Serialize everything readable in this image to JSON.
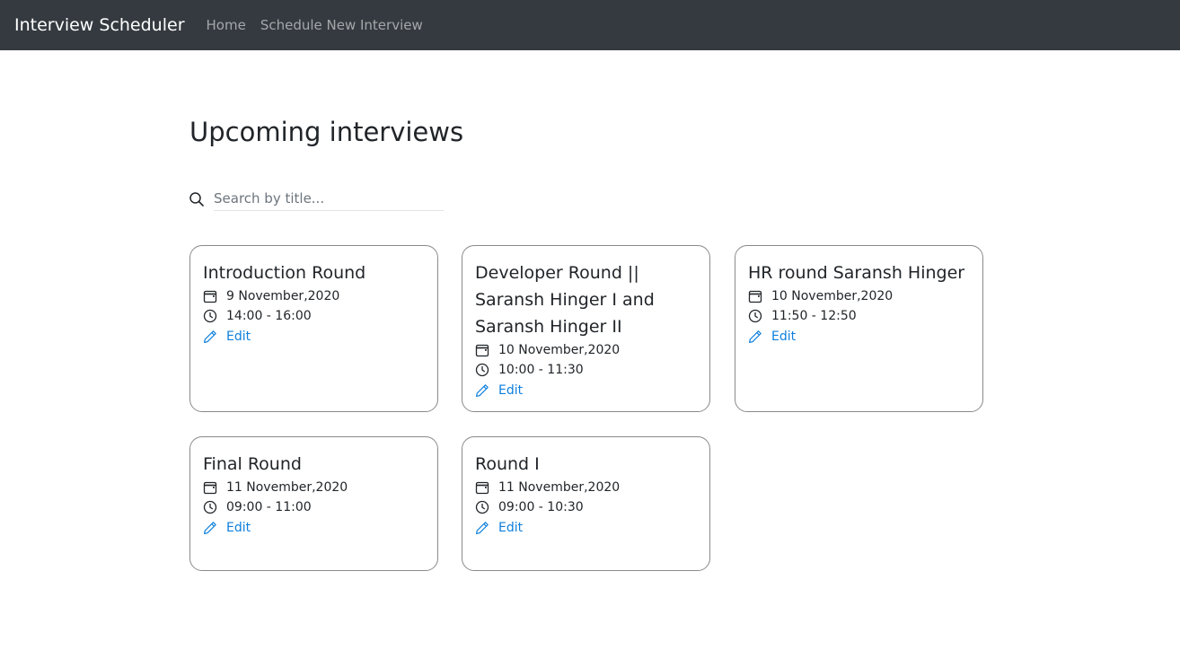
{
  "navbar": {
    "brand": "Interview Scheduler",
    "links": [
      "Home",
      "Schedule New Interview"
    ]
  },
  "main": {
    "title": "Upcoming interviews",
    "search": {
      "placeholder": "Search by title...",
      "value": ""
    }
  },
  "interviews": [
    {
      "title": "Introduction Round",
      "date": "9 November,2020",
      "time": "14:00 - 16:00",
      "edit_label": "Edit"
    },
    {
      "title": "Developer Round || Saransh Hinger I and Saransh Hinger II",
      "date": "10 November,2020",
      "time": "10:00 - 11:30",
      "edit_label": "Edit"
    },
    {
      "title": "HR round Saransh Hinger",
      "date": "10 November,2020",
      "time": "11:50 - 12:50",
      "edit_label": "Edit"
    },
    {
      "title": "Final Round",
      "date": "11 November,2020",
      "time": "09:00 - 11:00",
      "edit_label": "Edit"
    },
    {
      "title": "Round I",
      "date": "11 November,2020",
      "time": "09:00 - 10:30",
      "edit_label": "Edit"
    }
  ],
  "icons": {
    "date": "calendar-icon",
    "time": "clock-icon",
    "edit": "pencil-icon",
    "search": "search-icon"
  },
  "colors": {
    "navbar": "#343a40",
    "link": "#0d7fdc"
  }
}
